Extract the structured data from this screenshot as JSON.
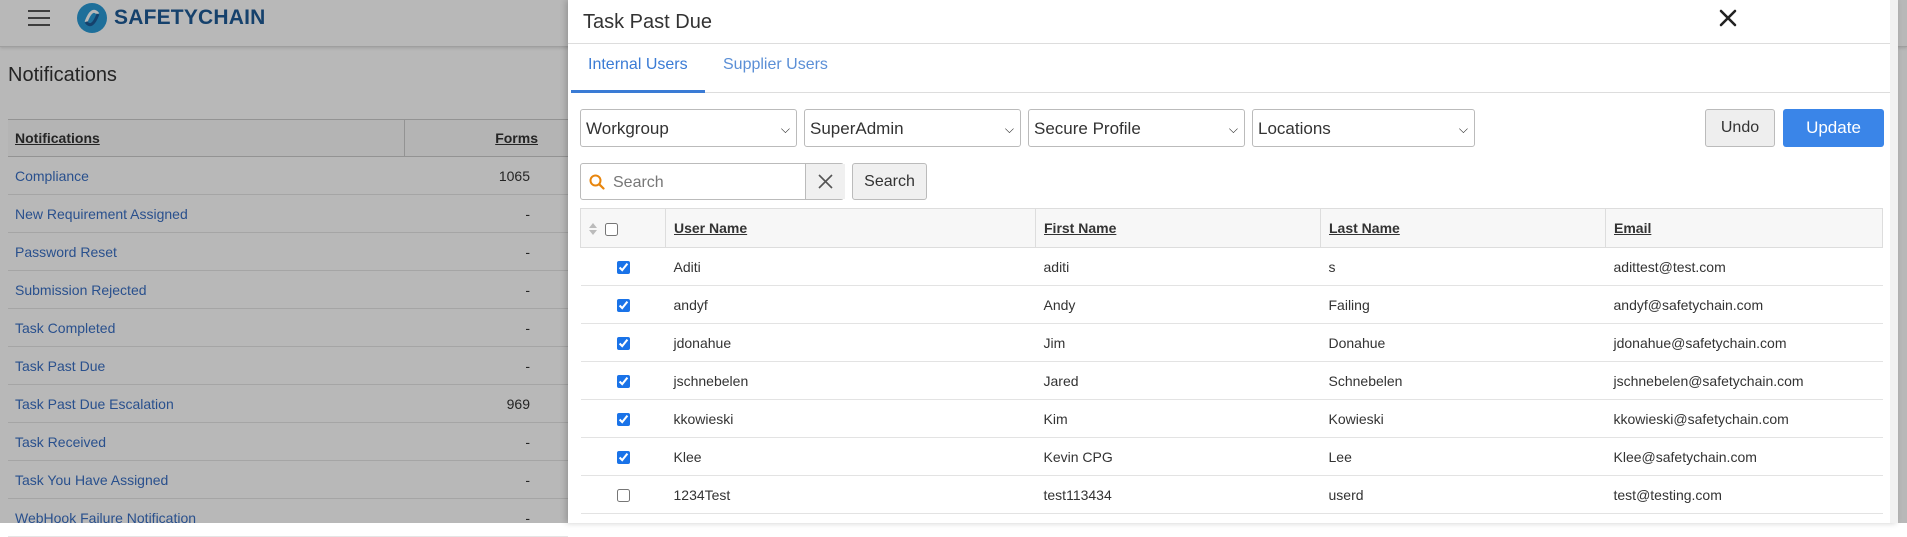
{
  "app": {
    "logo_text": "SAFETYCHAIN"
  },
  "background": {
    "page_title": "Notifications",
    "table": {
      "headers": {
        "notifications": "Notifications",
        "forms": "Forms"
      },
      "rows": [
        {
          "name": "Compliance",
          "forms": "1065"
        },
        {
          "name": "New Requirement Assigned",
          "forms": "-"
        },
        {
          "name": "Password Reset",
          "forms": "-"
        },
        {
          "name": "Submission Rejected",
          "forms": "-"
        },
        {
          "name": "Task Completed",
          "forms": "-"
        },
        {
          "name": "Task Past Due",
          "forms": "-"
        },
        {
          "name": "Task Past Due Escalation",
          "forms": "969"
        },
        {
          "name": "Task Received",
          "forms": "-"
        },
        {
          "name": "Task You Have Assigned",
          "forms": "-"
        },
        {
          "name": "WebHook Failure Notification",
          "forms": "-"
        }
      ]
    }
  },
  "modal": {
    "title": "Task Past Due",
    "tabs": [
      {
        "label": "Internal Users",
        "active": true
      },
      {
        "label": "Supplier Users",
        "active": false
      }
    ],
    "filters": {
      "workgroup": "Workgroup",
      "role": "SuperAdmin",
      "profile": "Secure Profile",
      "locations": "Locations"
    },
    "buttons": {
      "undo": "Undo",
      "update": "Update",
      "search": "Search"
    },
    "search": {
      "placeholder": "Search",
      "value": ""
    },
    "table": {
      "columns": [
        "User Name",
        "First Name",
        "Last Name",
        "Email"
      ],
      "rows": [
        {
          "checked": true,
          "username": "Aditi",
          "first": "aditi",
          "last": "s",
          "email": "adittest@test.com"
        },
        {
          "checked": true,
          "username": "andyf",
          "first": "Andy",
          "last": "Failing",
          "email": "andyf@safetychain.com"
        },
        {
          "checked": true,
          "username": "jdonahue",
          "first": "Jim",
          "last": "Donahue",
          "email": "jdonahue@safetychain.com"
        },
        {
          "checked": true,
          "username": "jschnebelen",
          "first": "Jared",
          "last": "Schnebelen",
          "email": "jschnebelen@safetychain.com"
        },
        {
          "checked": true,
          "username": "kkowieski",
          "first": "Kim",
          "last": "Kowieski",
          "email": "kkowieski@safetychain.com"
        },
        {
          "checked": true,
          "username": "Klee",
          "first": "Kevin CPG",
          "last": "Lee",
          "email": "Klee@safetychain.com"
        },
        {
          "checked": false,
          "username": "1234Test",
          "first": "test113434",
          "last": "userd",
          "email": "test@testing.com"
        }
      ]
    }
  },
  "colors": {
    "accent": "#3a85e8",
    "link": "#3a6fc4",
    "brand": "#1e5a96"
  },
  "icons": [
    "menu-icon",
    "logo-icon",
    "close-icon",
    "search-icon",
    "clear-icon",
    "sort-icon",
    "chevron-down-icon"
  ]
}
